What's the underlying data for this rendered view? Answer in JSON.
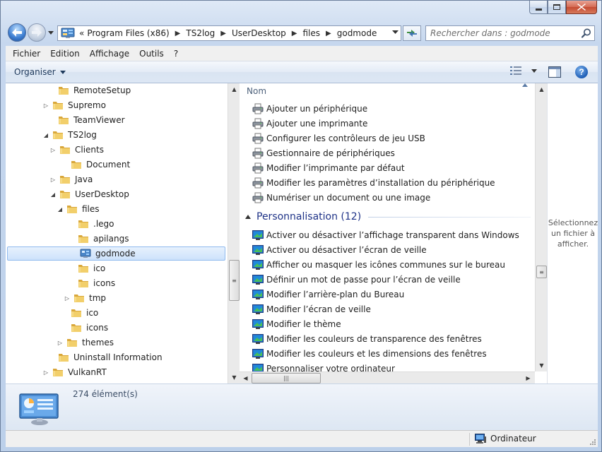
{
  "window": {
    "caption_buttons": [
      "minimize",
      "maximize",
      "close"
    ]
  },
  "navigation": {
    "breadcrumb": [
      "Program Files (x86)",
      "TS2log",
      "UserDesktop",
      "files",
      "godmode"
    ],
    "overflow_symbol": "«",
    "separator": "▶",
    "search_placeholder": "Rechercher dans : godmode"
  },
  "menu": {
    "items": [
      "Fichier",
      "Edition",
      "Affichage",
      "Outils",
      "?"
    ]
  },
  "toolbar": {
    "organize_label": "Organiser",
    "help_label": "?"
  },
  "tree": {
    "items": [
      {
        "label": "RemoteSetup",
        "expander": "none"
      },
      {
        "label": "Supremo",
        "expander": "collapsed"
      },
      {
        "label": "TeamViewer",
        "expander": "none"
      },
      {
        "label": "TS2log",
        "expander": "expanded"
      },
      {
        "label": "Clients",
        "expander": "collapsed"
      },
      {
        "label": "Document",
        "expander": "none"
      },
      {
        "label": "Java",
        "expander": "collapsed"
      },
      {
        "label": "UserDesktop",
        "expander": "expanded"
      },
      {
        "label": "files",
        "expander": "expanded"
      },
      {
        "label": ".lego",
        "expander": "none"
      },
      {
        "label": "apilangs",
        "expander": "none"
      },
      {
        "label": "godmode",
        "expander": "none",
        "selected": true,
        "icon": "control-panel-icon"
      },
      {
        "label": "ico",
        "expander": "none"
      },
      {
        "label": "icons",
        "expander": "none"
      },
      {
        "label": "tmp",
        "expander": "collapsed"
      },
      {
        "label": "ico",
        "expander": "none"
      },
      {
        "label": "icons",
        "expander": "none"
      },
      {
        "label": "themes",
        "expander": "collapsed"
      },
      {
        "label": "Uninstall Information",
        "expander": "none"
      },
      {
        "label": "VulkanRT",
        "expander": "collapsed"
      }
    ]
  },
  "file_list": {
    "column_header": "Nom",
    "device_items": [
      "Ajouter un périphérique",
      "Ajouter une imprimante",
      "Configurer les contrôleurs de jeu USB",
      "Gestionnaire de périphériques",
      "Modifier l’imprimante par défaut",
      "Modifier les paramètres d’installation du périphérique",
      "Numériser un document ou une image"
    ],
    "group": {
      "title": "Personnalisation (12)",
      "items": [
        "Activer ou désactiver l’affichage transparent dans Windows",
        "Activer ou désactiver l’écran de veille",
        "Afficher ou masquer les icônes communes sur le bureau",
        "Définir un mot de passe pour l’écran de veille",
        "Modifier l’arrière-plan du Bureau",
        "Modifier l’écran de veille",
        "Modifier le thème",
        "Modifier les couleurs de transparence des fenêtres",
        "Modifier les couleurs et les dimensions des fenêtres",
        "Personnaliser votre ordinateur"
      ]
    }
  },
  "preview": {
    "message": "Sélectionnez un fichier à afficher."
  },
  "details": {
    "count": "274 élément(s)"
  },
  "status": {
    "location": "Ordinateur"
  },
  "colors": {
    "group_title": "#1e3287",
    "selection_border": "#8fb9ee",
    "folder": "#e8c35a"
  }
}
